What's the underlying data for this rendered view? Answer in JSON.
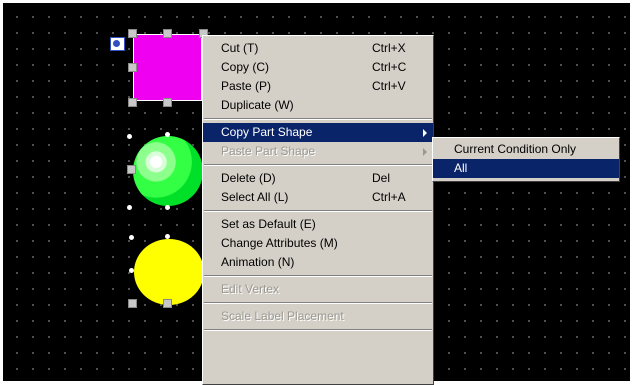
{
  "colors": {
    "canvas_bg": "#000000",
    "menu_bg": "#d4d0c8",
    "highlight": "#0a246a",
    "magenta_part": "#f000f0",
    "green_lamp": "#00e028",
    "yellow_lamp": "#ffff00"
  },
  "canvas": {
    "parts": [
      {
        "name": "rectangle-part",
        "color": "magenta",
        "selected": true
      },
      {
        "name": "lamp-part-green",
        "color": "green",
        "selected": true
      },
      {
        "name": "lamp-part-yellow",
        "color": "yellow",
        "selected": true
      }
    ],
    "zoom_icon": "magnifier-icon"
  },
  "context_menu": {
    "cut": {
      "label": "Cut (T)",
      "shortcut": "Ctrl+X"
    },
    "copy": {
      "label": "Copy (C)",
      "shortcut": "Ctrl+C"
    },
    "paste": {
      "label": "Paste (P)",
      "shortcut": "Ctrl+V"
    },
    "duplicate": {
      "label": "Duplicate (W)"
    },
    "copy_part_shape": {
      "label": "Copy Part Shape",
      "state": "highlighted"
    },
    "paste_part_shape": {
      "label": "Paste Part Shape",
      "state": "disabled"
    },
    "delete": {
      "label": "Delete (D)",
      "shortcut": "Del"
    },
    "select_all": {
      "label": "Select All (L)",
      "shortcut": "Ctrl+A"
    },
    "set_default": {
      "label": "Set as Default (E)"
    },
    "change_attributes": {
      "label": "Change Attributes (M)"
    },
    "animation": {
      "label": "Animation (N)"
    },
    "edit_vertex": {
      "label": "Edit Vertex",
      "state": "disabled"
    },
    "scale_label": {
      "label": "Scale Label Placement",
      "state": "disabled"
    }
  },
  "submenu": {
    "current_condition": {
      "label": "Current Condition Only"
    },
    "all": {
      "label": "All",
      "state": "highlighted"
    }
  }
}
